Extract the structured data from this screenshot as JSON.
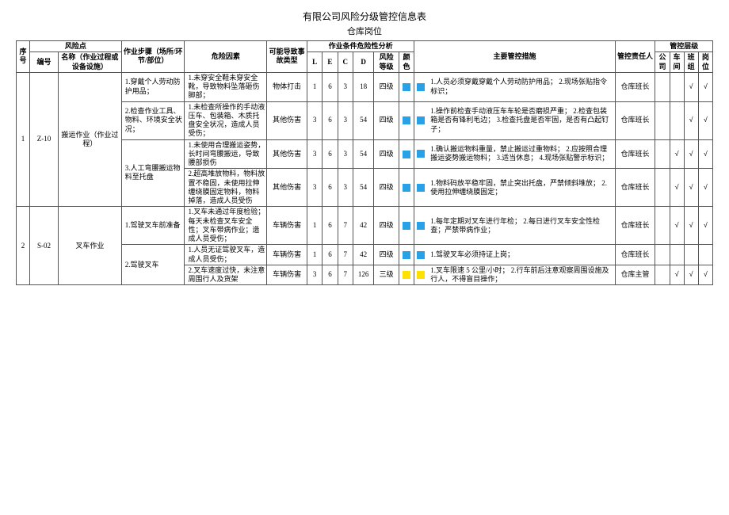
{
  "title": "有限公司风险分级管控信息表",
  "subtitle": "仓库岗位",
  "headers": {
    "seq": "序号",
    "risk_point": "风险点",
    "code": "编号",
    "name": "名称（作业过程或设备设施）",
    "steps": "作业步骤（场所/环节/部位）",
    "factors": "危险因素",
    "accident": "可能导致事故类型",
    "analysis": "作业条件危险性分析",
    "L": "L",
    "E": "E",
    "C": "C",
    "D": "D",
    "level": "风险等级",
    "color": "颜色",
    "measures": "主要管控措施",
    "responsible": "管控责任人",
    "ctrl_level": "管控层级",
    "t1": "公司",
    "t2": "车间",
    "t3": "班组",
    "t4": "岗位"
  },
  "rows": [
    {
      "seq": "1",
      "code": "Z-10",
      "name": "搬运作业（作业过程）",
      "step": "1.穿戴个人劳动防护用品；",
      "factor": "1.未穿安全鞋未穿安全靴，导致物料坠落砸伤脚部；",
      "acc": "物体打击",
      "L": "1",
      "E": "6",
      "C": "3",
      "D": "18",
      "lvl": "四级",
      "clr": "blue",
      "meas": "1.人员必须穿戴穿戴个人劳动防护用品；\n2.现场张贴指令标识；",
      "resp": "仓库班长",
      "tiers": [
        "",
        "",
        "√",
        "√"
      ]
    },
    {
      "step": "2.检查作业工具、物料、环境安全状况；",
      "factor": "1.未检查所操作的手动液压车、包装箱、木质托盘安全状况，造成人员受伤；",
      "acc": "其他伤害",
      "L": "3",
      "E": "6",
      "C": "3",
      "D": "54",
      "lvl": "四级",
      "clr": "blue",
      "meas": "1.操作前检查手动液压车车轮是否磨损严重；\n2.检查包装箱是否有锋利毛边；\n3.检查托盘是否牢固，是否有凸起钉子；",
      "resp": "仓库班长",
      "tiers": [
        "",
        "",
        "√",
        "√"
      ]
    },
    {
      "step": "3.人工弯腰搬运物料至托盘",
      "factor": "1.未使用合理搬运姿势，长时间弯腰搬运，导致腰部损伤",
      "acc": "其他伤害",
      "L": "3",
      "E": "6",
      "C": "3",
      "D": "54",
      "lvl": "四级",
      "clr": "blue",
      "meas": "1.确认搬运物料重量，禁止搬运过重物料；\n2.应按照合理搬运姿势搬运物料；\n3.适当休息；\n4.现场张贴警示标识；",
      "resp": "仓库班长",
      "tiers": [
        "",
        "√",
        "√",
        "√"
      ]
    },
    {
      "factor": "2.超高堆放物料，物料放置不稳固，未使用拉伸缠绕膜固定物料，物料掉落，造成人员受伤",
      "acc": "其他伤害",
      "L": "3",
      "E": "6",
      "C": "3",
      "D": "54",
      "lvl": "四级",
      "clr": "blue",
      "meas": "1.物料码放平稳牢固，禁止突出托盘，严禁倾斜堆放；\n2.使用拉伸缠绕膜固定；",
      "resp": "仓库班长",
      "tiers": [
        "",
        "√",
        "√",
        "√"
      ]
    },
    {
      "seq": "2",
      "code": "S-02",
      "name": "叉车作业",
      "step": "1.驾驶叉车前准备",
      "factor": "1.叉车未通过年度检验；每天未检查叉车安全性；叉车带病作业；造成人员受伤；",
      "acc": "车辆伤害",
      "L": "1",
      "E": "6",
      "C": "7",
      "D": "42",
      "lvl": "四级",
      "clr": "blue",
      "meas": "1.每年定期对叉车进行年检；\n2.每日进行叉车安全性检查；严禁带病作业；",
      "resp": "仓库班长",
      "tiers": [
        "",
        "√",
        "√",
        "√"
      ]
    },
    {
      "step": "2.驾驶叉车",
      "factor": "1.人员无证驾驶叉车，造成人员受伤；",
      "acc": "车辆伤害",
      "L": "1",
      "E": "6",
      "C": "7",
      "D": "42",
      "lvl": "四级",
      "clr": "blue",
      "meas": "1.驾驶叉车必须持证上岗；",
      "resp": "仓库班长",
      "tiers": [
        "",
        "",
        "",
        ""
      ]
    },
    {
      "factor": "2.叉车速度过快，未注意周围行人及货架",
      "acc": "车辆伤害",
      "L": "3",
      "E": "6",
      "C": "7",
      "D": "126",
      "lvl": "三级",
      "clr": "yellow",
      "meas": "1.叉车限速 5 公里/小时；\n2.行车前后注意观察周围设施及行人，不得盲目操作；",
      "resp": "仓库主管",
      "tiers": [
        "",
        "√",
        "√",
        "√"
      ]
    }
  ]
}
